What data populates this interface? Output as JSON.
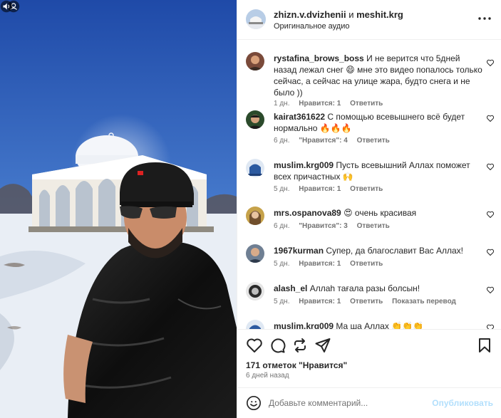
{
  "header": {
    "user1": "zhizn.v.dvizhenii",
    "conjunction": "и",
    "user2": "meshit.krg",
    "audio": "Оригинальное аудио",
    "more_icon": "more-horizontal-icon"
  },
  "comments": [
    {
      "user": "rystafina_brows_boss",
      "text": "И не верится что 5дней назад лежал снег 😄 мне это видео попалось только сейчас, а сейчас на улице жара, будто снега и не было ))",
      "time": "1 дн.",
      "likes": "Нравится: 1",
      "reply": "Ответить"
    },
    {
      "user": "kairat361622",
      "text": "С помощью всевышнего всё будет нормально 🔥🔥🔥",
      "time": "6 дн.",
      "likes": "\"Нравится\": 4",
      "reply": "Ответить"
    },
    {
      "user": "muslim.krg009",
      "text": "Пусть всевышний Аллах поможет всех причастных 🙌",
      "time": "5 дн.",
      "likes": "Нравится: 1",
      "reply": "Ответить"
    },
    {
      "user": "mrs.ospanova89",
      "text": "😍 очень красивая",
      "time": "6 дн.",
      "likes": "\"Нравится\": 3",
      "reply": "Ответить"
    },
    {
      "user": "1967kurman",
      "text": "Супер, да благославит Вас Аллах!",
      "time": "5 дн.",
      "likes": "Нравится: 1",
      "reply": "Ответить"
    },
    {
      "user": "alash_el",
      "text": "Аллаh тағала разы болсын!",
      "time": "5 дн.",
      "likes": "Нравится: 1",
      "reply": "Ответить",
      "translate": "Показать перевод"
    },
    {
      "user": "muslim.krg009",
      "text": "Ма ша Аллах 👏👏👏",
      "time": "",
      "likes": "",
      "reply": ""
    }
  ],
  "actions": {
    "icons": [
      "heart-icon",
      "comment-icon",
      "repost-icon",
      "share-icon",
      "save-icon"
    ]
  },
  "likes_count": "171 отметок \"Нравится\"",
  "posted_ago": "6 дней назад",
  "add_comment": {
    "placeholder": "Добавьте комментарий...",
    "publish": "Опубликовать"
  },
  "colors": {
    "link_blue_disabled": "#b2dffc",
    "secondary_text": "#737373",
    "sky_blue": "#2f5fb8"
  }
}
